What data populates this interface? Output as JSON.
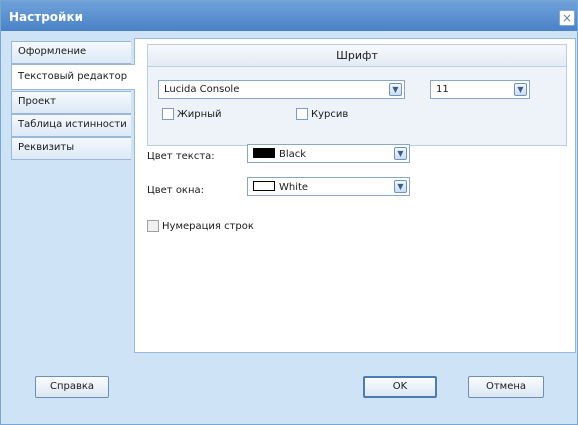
{
  "window": {
    "title": "Настройки",
    "close_label": "×"
  },
  "tabs": [
    {
      "label": "Оформление"
    },
    {
      "label": "Текстовый редактор"
    },
    {
      "label": "Проект"
    },
    {
      "label": "Таблица истинности"
    },
    {
      "label": "Реквизиты"
    }
  ],
  "font": {
    "header": "Шрифт",
    "family": "Lucida Console",
    "size": "11",
    "bold_label": "Жирный",
    "italic_label": "Курсив"
  },
  "text_color": {
    "label": "Цвет текста:",
    "value": "Black",
    "swatch": "#000000"
  },
  "window_color": {
    "label": "Цвет окна:",
    "value": "White",
    "swatch": "#ffffff"
  },
  "line_numbers": {
    "label": "Нумерация строк"
  },
  "buttons": {
    "help": "Справка",
    "ok": "OK",
    "cancel": "Отмена"
  }
}
